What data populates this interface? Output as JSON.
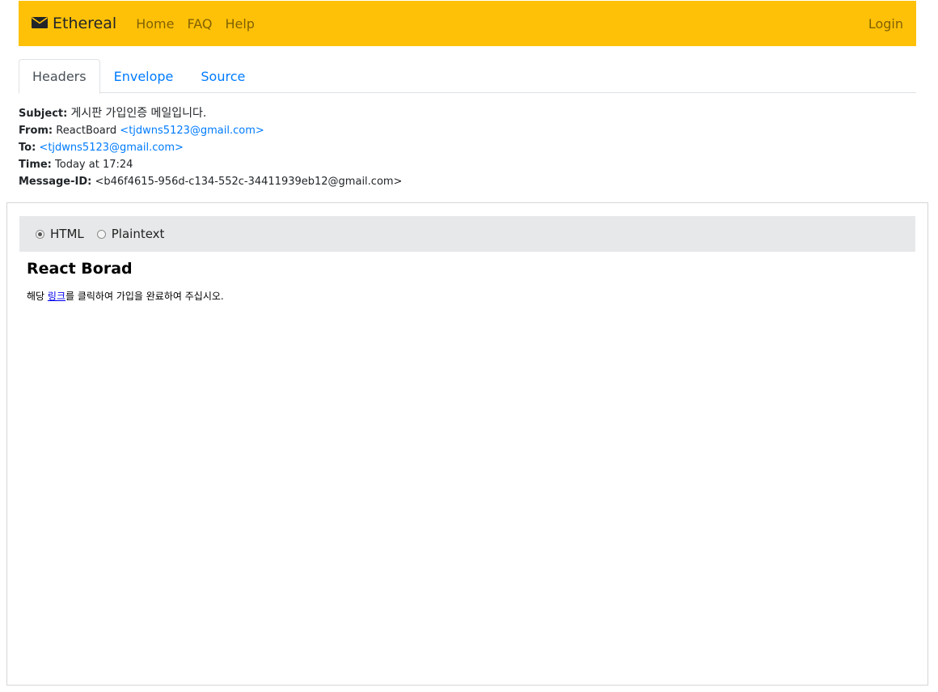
{
  "navbar": {
    "brand": "Ethereal",
    "links": [
      "Home",
      "FAQ",
      "Help"
    ],
    "login": "Login",
    "brand_color": "#ffc107"
  },
  "tabs": [
    {
      "label": "Headers",
      "active": true
    },
    {
      "label": "Envelope",
      "active": false
    },
    {
      "label": "Source",
      "active": false
    }
  ],
  "headers": {
    "subject_label": "Subject:",
    "subject": "게시판 가입인증 메일입니다.",
    "from_label": "From:",
    "from_name": "ReactBoard",
    "from_email": "<tjdwns5123@gmail.com>",
    "to_label": "To:",
    "to_email": "<tjdwns5123@gmail.com>",
    "time_label": "Time:",
    "time": "Today at 17:24",
    "message_id_label": "Message-ID:",
    "message_id": "<b46f4615-956d-c134-552c-34411939eb12@gmail.com>"
  },
  "format": {
    "options": [
      {
        "label": "HTML",
        "checked": true
      },
      {
        "label": "Plaintext",
        "checked": false
      }
    ]
  },
  "message": {
    "title": "React Borad",
    "text_before": "해당 ",
    "link_text": "링크",
    "text_after": "를 클릭하여 가입을 완료하여 주십시오."
  },
  "icons": {
    "brand_icon": "envelope-icon"
  }
}
